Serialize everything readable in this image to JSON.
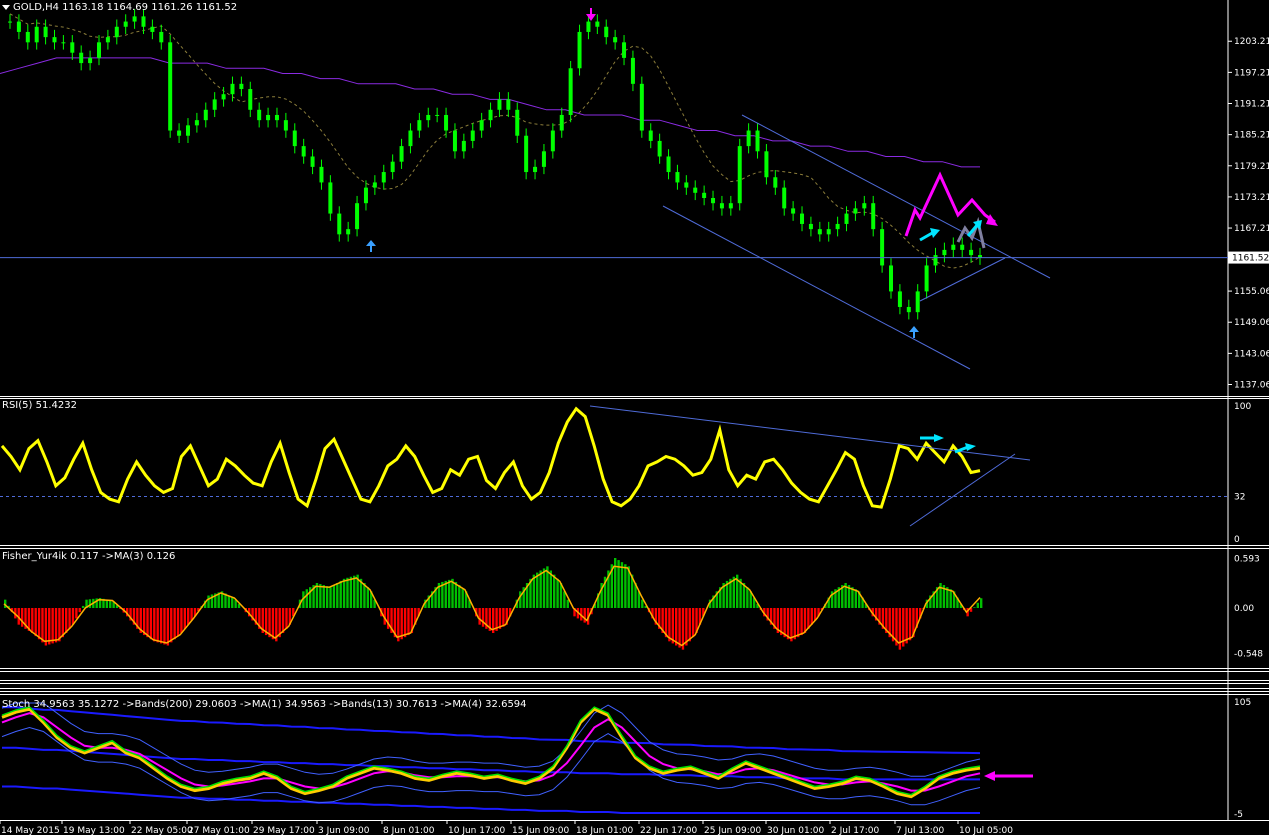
{
  "header": {
    "symbol": "GOLD,H4",
    "ohlc": "1163.18 1164.69 1161.26 1161.52",
    "menu_icon": "triangle-down-icon"
  },
  "colors": {
    "background": "#000000",
    "bull_candle": "#00ff00",
    "grid_text": "#ffffff",
    "ma_slow": "#8a2be2",
    "ma_dashed": "#8b7d3a",
    "channel": "#4f6bd8",
    "price_line": "#4f6bd8",
    "rsi_line": "#ffff00",
    "fisher_pos": "#00c000",
    "fisher_neg": "#ff0000",
    "fisher_ma": "#ffb000",
    "stoch_bands": "#1a1aff",
    "annot_magenta": "#ff00ff",
    "annot_cyan": "#00e5ff",
    "annot_grey": "#8080a0",
    "arrow_blue": "#3aa0ff"
  },
  "chart_data": [
    {
      "type": "line",
      "title": "GOLD,H4",
      "pane": "price",
      "y_ticks": [
        "1203.21",
        "1197.21",
        "1191.21",
        "1185.21",
        "1179.21",
        "1173.21",
        "1167.21",
        "1161.52",
        "1155.06",
        "1149.06",
        "1143.06",
        "1137.06"
      ],
      "ylim": [
        1136,
        1210
      ],
      "last_price": "1161.52",
      "series": [
        {
          "values": [
            1207,
            1205,
            1203,
            1206,
            1204,
            1203,
            1203,
            1201,
            1199,
            1200,
            1203,
            1204,
            1206,
            1207,
            1208,
            1206,
            1205,
            1203,
            1186,
            1185,
            1187,
            1188,
            1190,
            1192,
            1193,
            1195,
            1194,
            1190,
            1188,
            1189,
            1188,
            1186,
            1183,
            1181,
            1179,
            1176,
            1170,
            1166,
            1167,
            1172,
            1175,
            1176,
            1178,
            1180,
            1183,
            1186,
            1188,
            1189,
            1189,
            1186,
            1182,
            1184,
            1186,
            1188,
            1190,
            1192,
            1190,
            1185,
            1178,
            1179,
            1182,
            1186,
            1189,
            1198,
            1205,
            1207,
            1206,
            1204,
            1203,
            1200,
            1195,
            1186,
            1184,
            1181,
            1178,
            1176,
            1175,
            1174,
            1173,
            1172,
            1171,
            1172,
            1183,
            1186,
            1182,
            1177,
            1175,
            1171,
            1170,
            1168,
            1167,
            1166,
            1167,
            1168,
            1170,
            1171,
            1172,
            1167,
            1160,
            1155,
            1152,
            1151,
            1155,
            1160,
            1162,
            1163,
            1164,
            1163,
            1162,
            1161.52
          ]
        }
      ],
      "moving_averages": [
        {
          "values": [
            1197,
            1198,
            1199,
            1200,
            1200,
            1200,
            1200,
            1200,
            1200,
            1199,
            1199,
            1199,
            1198,
            1198,
            1198,
            1197,
            1197,
            1196,
            1196,
            1195,
            1195,
            1195,
            1194,
            1194,
            1193,
            1193,
            1192,
            1192,
            1191,
            1190,
            1190,
            1189,
            1189,
            1189,
            1188,
            1188,
            1187,
            1186,
            1186,
            1185,
            1185,
            1184,
            1184,
            1183,
            1183,
            1182,
            1182,
            1181,
            1181,
            1180,
            1180,
            1179,
            1179
          ]
        }
      ],
      "channel": {
        "upper": [
          1189,
          1160
        ],
        "lower": [
          1171,
          1141
        ]
      },
      "annotations": [
        "magenta-zigzag",
        "cyan-arrows",
        "blue-up-arrows",
        "magenta-down-arrow"
      ]
    },
    {
      "type": "line",
      "title": "RSI(5) 51.4232",
      "pane": "rsi",
      "y_ticks": [
        "100",
        "32",
        "0"
      ],
      "ylim": [
        0,
        100
      ],
      "series": [
        {
          "name": "RSI(5)",
          "values": [
            70,
            62,
            52,
            68,
            74,
            58,
            40,
            46,
            60,
            72,
            52,
            35,
            30,
            28,
            45,
            58,
            48,
            40,
            35,
            38,
            62,
            70,
            55,
            40,
            45,
            60,
            55,
            48,
            42,
            40,
            58,
            72,
            50,
            30,
            25,
            45,
            68,
            75,
            60,
            45,
            30,
            28,
            40,
            55,
            60,
            70,
            62,
            48,
            35,
            38,
            52,
            48,
            60,
            62,
            44,
            38,
            50,
            58,
            40,
            30,
            35,
            50,
            72,
            88,
            98,
            92,
            70,
            45,
            28,
            25,
            30,
            40,
            55,
            58,
            62,
            60,
            55,
            48,
            50,
            60,
            82,
            52,
            40,
            48,
            45,
            58,
            60,
            52,
            42,
            35,
            30,
            28,
            40,
            52,
            65,
            60,
            40,
            25,
            24,
            45,
            70,
            68,
            60,
            72,
            65,
            58,
            70,
            62,
            50,
            51.42
          ]
        }
      ]
    },
    {
      "type": "bar",
      "title": "Fisher_Yur4ik 0.117 ->MA(3) 0.126",
      "pane": "fisher",
      "y_ticks": [
        "0.593",
        "0.00",
        "-0.548"
      ],
      "ylim": [
        -0.6,
        0.6
      ],
      "series": [
        {
          "name": "Fisher_Yur4ik",
          "values": [
            0.1,
            -0.2,
            -0.3,
            -0.45,
            -0.4,
            -0.2,
            0.1,
            0.12,
            0.08,
            -0.1,
            -0.3,
            -0.4,
            -0.45,
            -0.3,
            -0.1,
            0.15,
            0.2,
            0.1,
            -0.1,
            -0.3,
            -0.4,
            -0.2,
            0.2,
            0.3,
            0.25,
            0.35,
            0.4,
            0.2,
            -0.2,
            -0.4,
            -0.3,
            0.1,
            0.3,
            0.35,
            0.2,
            -0.2,
            -0.3,
            -0.2,
            0.2,
            0.4,
            0.5,
            0.3,
            -0.1,
            -0.2,
            0.3,
            0.6,
            0.5,
            0.1,
            -0.2,
            -0.4,
            -0.5,
            -0.3,
            0.1,
            0.3,
            0.4,
            0.2,
            -0.1,
            -0.3,
            -0.4,
            -0.3,
            -0.1,
            0.2,
            0.3,
            0.2,
            -0.1,
            -0.3,
            -0.5,
            -0.35,
            0.1,
            0.3,
            0.2,
            -0.1,
            0.117
          ]
        },
        {
          "name": "MA(3)",
          "values": [
            0.05,
            -0.1,
            -0.28,
            -0.4,
            -0.38,
            -0.22,
            0.0,
            0.1,
            0.09,
            -0.05,
            -0.25,
            -0.38,
            -0.42,
            -0.32,
            -0.12,
            0.1,
            0.18,
            0.12,
            -0.05,
            -0.25,
            -0.36,
            -0.22,
            0.1,
            0.26,
            0.25,
            0.32,
            0.36,
            0.22,
            -0.1,
            -0.35,
            -0.3,
            0.05,
            0.25,
            0.32,
            0.22,
            -0.12,
            -0.26,
            -0.2,
            0.12,
            0.35,
            0.45,
            0.32,
            0.0,
            -0.15,
            0.2,
            0.5,
            0.48,
            0.15,
            -0.15,
            -0.35,
            -0.45,
            -0.32,
            0.05,
            0.25,
            0.35,
            0.22,
            -0.05,
            -0.25,
            -0.36,
            -0.3,
            -0.12,
            0.15,
            0.26,
            0.2,
            -0.05,
            -0.25,
            -0.42,
            -0.35,
            0.05,
            0.25,
            0.2,
            -0.05,
            0.126
          ]
        }
      ]
    },
    {
      "type": "line",
      "title": "Stoch 34.9563 35.1272 ->Bands(200) 29.0603 ->MA(1) 34.9563 ->Bands(13) 30.7613 ->MA(4) 32.6594",
      "pane": "stoch",
      "y_ticks": [
        "105",
        "-5"
      ],
      "ylim": [
        -5,
        105
      ],
      "series": [
        {
          "name": "MA(1)",
          "values": [
            90,
            95,
            98,
            85,
            70,
            60,
            55,
            60,
            65,
            55,
            50,
            40,
            30,
            22,
            18,
            20,
            25,
            28,
            30,
            35,
            30,
            20,
            15,
            18,
            22,
            30,
            35,
            40,
            38,
            35,
            30,
            28,
            32,
            35,
            33,
            30,
            32,
            28,
            25,
            30,
            40,
            60,
            85,
            98,
            92,
            70,
            50,
            40,
            35,
            38,
            40,
            35,
            30,
            38,
            45,
            40,
            35,
            30,
            25,
            20,
            22,
            25,
            30,
            28,
            22,
            15,
            12,
            20,
            30,
            35,
            38,
            40
          ]
        },
        {
          "name": "MA(4)",
          "values": [
            85,
            90,
            94,
            90,
            80,
            70,
            62,
            60,
            60,
            58,
            54,
            46,
            38,
            30,
            24,
            22,
            23,
            25,
            27,
            30,
            30,
            26,
            22,
            20,
            21,
            25,
            30,
            35,
            37,
            36,
            33,
            31,
            31,
            32,
            32,
            31,
            31,
            29,
            27,
            28,
            33,
            45,
            62,
            80,
            88,
            80,
            66,
            52,
            44,
            40,
            39,
            37,
            34,
            35,
            39,
            40,
            38,
            34,
            30,
            26,
            24,
            24,
            26,
            27,
            25,
            22,
            18,
            18,
            22,
            27,
            32,
            35
          ]
        },
        {
          "name": "Bands(200)",
          "values": [
            60,
            60,
            59,
            58,
            58,
            57,
            56,
            55,
            54,
            53,
            52,
            51,
            50,
            49,
            49,
            48,
            48,
            47,
            47,
            46,
            46,
            45,
            45,
            44,
            44,
            43,
            43,
            42,
            42,
            41,
            41,
            40,
            40,
            39,
            39,
            38,
            38,
            37,
            37,
            36,
            36,
            36,
            35,
            35,
            35,
            34,
            34,
            34,
            33,
            33,
            33,
            32,
            32,
            32,
            31,
            31,
            31,
            30,
            30,
            30,
            30,
            29,
            29,
            29,
            29,
            29,
            29,
            29,
            29,
            29,
            29,
            29
          ]
        }
      ]
    }
  ],
  "x_axis": {
    "labels": [
      "14 May 2015",
      "19 May 13:00",
      "22 May 05:00",
      "27 May 01:00",
      "29 May 17:00",
      "3 Jun 09:00",
      "8 Jun 01:00",
      "10 Jun 17:00",
      "15 Jun 09:00",
      "18 Jun 01:00",
      "22 Jun 17:00",
      "25 Jun 09:00",
      "30 Jun 01:00",
      "2 Jul 17:00",
      "7 Jul 13:00",
      "10 Jul 05:00"
    ]
  }
}
